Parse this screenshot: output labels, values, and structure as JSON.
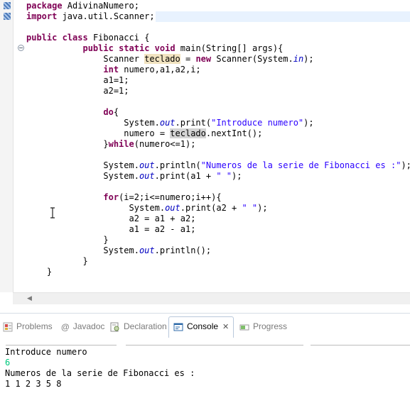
{
  "editor": {
    "lines": [
      {
        "id": "l1",
        "parts": [
          {
            "t": "package",
            "c": "kw"
          },
          {
            "t": " AdivinaNumero;"
          }
        ]
      },
      {
        "id": "l2",
        "parts": [
          {
            "t": "import",
            "c": "kw"
          },
          {
            "t": " java.util.Scanner;"
          }
        ]
      },
      {
        "id": "l3",
        "parts": []
      },
      {
        "id": "l4",
        "parts": [
          {
            "t": "public",
            "c": "kw"
          },
          {
            "t": " "
          },
          {
            "t": "class",
            "c": "kw"
          },
          {
            "t": " Fibonacci {"
          }
        ]
      },
      {
        "id": "l5",
        "parts": [
          {
            "t": "           "
          },
          {
            "t": "public",
            "c": "kw"
          },
          {
            "t": " "
          },
          {
            "t": "static",
            "c": "kw"
          },
          {
            "t": " "
          },
          {
            "t": "void",
            "c": "kw"
          },
          {
            "t": " main(String[] args){"
          }
        ]
      },
      {
        "id": "l6",
        "parts": [
          {
            "t": "               Scanner "
          },
          {
            "t": "teclado",
            "c": "occ"
          },
          {
            "t": " = "
          },
          {
            "t": "new",
            "c": "kw"
          },
          {
            "t": " Scanner(System."
          },
          {
            "t": "in",
            "c": "it"
          },
          {
            "t": ");"
          }
        ]
      },
      {
        "id": "l7",
        "parts": [
          {
            "t": "               "
          },
          {
            "t": "int",
            "c": "kw"
          },
          {
            "t": " numero,a1,a2,i;"
          }
        ]
      },
      {
        "id": "l8",
        "parts": [
          {
            "t": "               a1=1;"
          }
        ]
      },
      {
        "id": "l9",
        "parts": [
          {
            "t": "               a2=1;"
          }
        ]
      },
      {
        "id": "l10",
        "parts": []
      },
      {
        "id": "l11",
        "parts": [
          {
            "t": "               "
          },
          {
            "t": "do",
            "c": "kw"
          },
          {
            "t": "{"
          }
        ]
      },
      {
        "id": "l12",
        "parts": [
          {
            "t": "                   System."
          },
          {
            "t": "out",
            "c": "it"
          },
          {
            "t": ".print("
          },
          {
            "t": "\"Introduce numero\"",
            "c": "st"
          },
          {
            "t": ");"
          }
        ]
      },
      {
        "id": "l13",
        "parts": [
          {
            "t": "                   numero = "
          },
          {
            "t": "teclado",
            "c": "occ2"
          },
          {
            "t": ".nextInt();"
          }
        ]
      },
      {
        "id": "l14",
        "parts": [
          {
            "t": "               }"
          },
          {
            "t": "while",
            "c": "kw"
          },
          {
            "t": "(numero<=1);"
          }
        ]
      },
      {
        "id": "l15",
        "parts": []
      },
      {
        "id": "l16",
        "parts": [
          {
            "t": "               System."
          },
          {
            "t": "out",
            "c": "it"
          },
          {
            "t": ".println("
          },
          {
            "t": "\"Numeros de la serie de Fibonacci es :\"",
            "c": "st"
          },
          {
            "t": ");"
          }
        ]
      },
      {
        "id": "l17",
        "parts": [
          {
            "t": "               System."
          },
          {
            "t": "out",
            "c": "it"
          },
          {
            "t": ".print(a1 + "
          },
          {
            "t": "\" \"",
            "c": "st"
          },
          {
            "t": ");"
          }
        ]
      },
      {
        "id": "l18",
        "parts": []
      },
      {
        "id": "l19",
        "parts": [
          {
            "t": "               "
          },
          {
            "t": "for",
            "c": "kw"
          },
          {
            "t": "(i=2;i<=numero;i++){"
          }
        ]
      },
      {
        "id": "l20",
        "parts": [
          {
            "t": "                    System."
          },
          {
            "t": "out",
            "c": "it"
          },
          {
            "t": ".print(a2 + "
          },
          {
            "t": "\" \"",
            "c": "st"
          },
          {
            "t": ");"
          }
        ]
      },
      {
        "id": "l21",
        "parts": [
          {
            "t": "                    a2 = a1 + a2;"
          }
        ]
      },
      {
        "id": "l22",
        "parts": [
          {
            "t": "                    a1 = a2 - a1;"
          }
        ]
      },
      {
        "id": "l23",
        "parts": [
          {
            "t": "               }"
          }
        ]
      },
      {
        "id": "l24",
        "parts": [
          {
            "t": "               System."
          },
          {
            "t": "out",
            "c": "it"
          },
          {
            "t": ".println();"
          }
        ]
      },
      {
        "id": "l25",
        "parts": [
          {
            "t": "           }"
          }
        ]
      },
      {
        "id": "l26",
        "parts": [
          {
            "t": "    }"
          }
        ]
      }
    ]
  },
  "views": {
    "tabs": [
      {
        "id": "problems",
        "label": "Problems",
        "icon": "problems-icon",
        "active": false
      },
      {
        "id": "javadoc",
        "label": "Javadoc",
        "icon": "at-javadoc-icon",
        "active": false
      },
      {
        "id": "declaration",
        "label": "Declaration",
        "icon": "declaration-icon",
        "active": false
      },
      {
        "id": "console",
        "label": "Console",
        "icon": "console-icon",
        "active": true
      },
      {
        "id": "progress",
        "label": "Progress",
        "icon": "progress-icon",
        "active": false
      }
    ],
    "close_glyph": "✕",
    "javadoc_glyph": "@"
  },
  "console": {
    "lines": [
      {
        "text": "Introduce numero",
        "kind": "output"
      },
      {
        "text": "6",
        "kind": "input"
      },
      {
        "text": "Numeros de la serie de Fibonacci es :",
        "kind": "output"
      },
      {
        "text": "1 1 2 3 5 8",
        "kind": "output"
      }
    ]
  },
  "colors": {
    "keyword": "#7f0055",
    "string": "#2a00ff",
    "field": "#0000c0",
    "console_input": "#00c87d",
    "occurrence": "#f1e3c0"
  }
}
